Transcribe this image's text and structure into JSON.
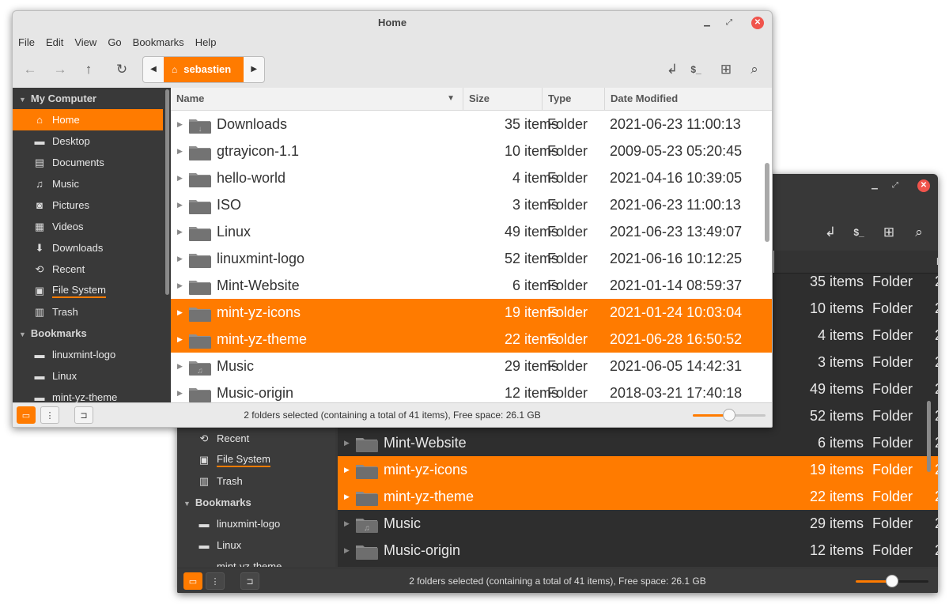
{
  "colors": {
    "accent": "#ff7b00",
    "sidebar_bg": "#393939",
    "dark_bg": "#2e2e2e",
    "close_button": "#f0544c"
  },
  "window": {
    "title": "Home"
  },
  "menu": [
    "File",
    "Edit",
    "View",
    "Go",
    "Bookmarks",
    "Help"
  ],
  "toolbar": {
    "back_icon": "arrow-left-icon",
    "forward_icon": "arrow-right-icon",
    "up_icon": "arrow-up-icon",
    "reload_icon": "reload-icon",
    "breadcrumb": "sebastien",
    "open_in_terminal_icon": "terminal-icon",
    "new_folder_icon": "new-folder-icon",
    "search_icon": "search-icon",
    "toggle_location_icon": "return-arrow-icon"
  },
  "sidebar": {
    "sections": [
      {
        "title": "My Computer",
        "items": [
          {
            "label": "Home",
            "icon": "home-icon"
          },
          {
            "label": "Desktop",
            "icon": "desktop-icon"
          },
          {
            "label": "Documents",
            "icon": "document-icon"
          },
          {
            "label": "Music",
            "icon": "music-icon"
          },
          {
            "label": "Pictures",
            "icon": "camera-icon"
          },
          {
            "label": "Videos",
            "icon": "film-icon"
          },
          {
            "label": "Downloads",
            "icon": "download-icon"
          },
          {
            "label": "Recent",
            "icon": "clock-icon"
          },
          {
            "label": "File System",
            "icon": "drive-icon"
          },
          {
            "label": "Trash",
            "icon": "trash-icon"
          }
        ]
      },
      {
        "title": "Bookmarks",
        "items": [
          {
            "label": "linuxmint-logo",
            "icon": "folder-icon"
          },
          {
            "label": "Linux",
            "icon": "folder-icon"
          },
          {
            "label": "mint-yz-theme",
            "icon": "folder-icon"
          }
        ]
      }
    ]
  },
  "columns": {
    "name": "Name",
    "size": "Size",
    "type": "Type",
    "date": "Date Modified"
  },
  "files": [
    {
      "name": "Downloads",
      "size": "35 items",
      "type": "Folder",
      "date": "2021-06-23 11:00:13",
      "selected": false,
      "emblem": "download"
    },
    {
      "name": "gtrayicon-1.1",
      "size": "10 items",
      "type": "Folder",
      "date": "2009-05-23 05:20:45",
      "selected": false,
      "emblem": ""
    },
    {
      "name": "hello-world",
      "size": "4 items",
      "type": "Folder",
      "date": "2021-04-16 10:39:05",
      "selected": false,
      "emblem": ""
    },
    {
      "name": "ISO",
      "size": "3 items",
      "type": "Folder",
      "date": "2021-06-23 11:00:13",
      "selected": false,
      "emblem": ""
    },
    {
      "name": "Linux",
      "size": "49 items",
      "type": "Folder",
      "date": "2021-06-23 13:49:07",
      "selected": false,
      "emblem": ""
    },
    {
      "name": "linuxmint-logo",
      "size": "52 items",
      "type": "Folder",
      "date": "2021-06-16 10:12:25",
      "selected": false,
      "emblem": ""
    },
    {
      "name": "Mint-Website",
      "size": "6 items",
      "type": "Folder",
      "date": "2021-01-14 08:59:37",
      "selected": false,
      "emblem": ""
    },
    {
      "name": "mint-yz-icons",
      "size": "19 items",
      "type": "Folder",
      "date": "2021-01-24 10:03:04",
      "selected": true,
      "emblem": ""
    },
    {
      "name": "mint-yz-theme",
      "size": "22 items",
      "type": "Folder",
      "date": "2021-06-28 16:50:52",
      "selected": true,
      "emblem": ""
    },
    {
      "name": "Music",
      "size": "29 items",
      "type": "Folder",
      "date": "2021-06-05 14:42:31",
      "selected": false,
      "emblem": "music"
    },
    {
      "name": "Music-origin",
      "size": "12 items",
      "type": "Folder",
      "date": "2018-03-21 17:40:18",
      "selected": false,
      "emblem": ""
    }
  ],
  "status": {
    "text": "2 folders selected (containing a total of 41 items), Free space: 26.1 GB",
    "zoom_level": 0.5
  },
  "dark_window": {
    "sidebar_items": [
      {
        "label": "Recent",
        "icon": "clock-icon"
      },
      {
        "label": "File System",
        "icon": "drive-icon"
      },
      {
        "label": "Trash",
        "icon": "trash-icon"
      }
    ],
    "bookmarks_title": "Bookmarks",
    "bookmarks": [
      {
        "label": "linuxmint-logo",
        "icon": "folder-icon"
      },
      {
        "label": "Linux",
        "icon": "folder-icon"
      },
      {
        "label": "mint-yz-theme",
        "icon": "folder-icon"
      }
    ]
  }
}
